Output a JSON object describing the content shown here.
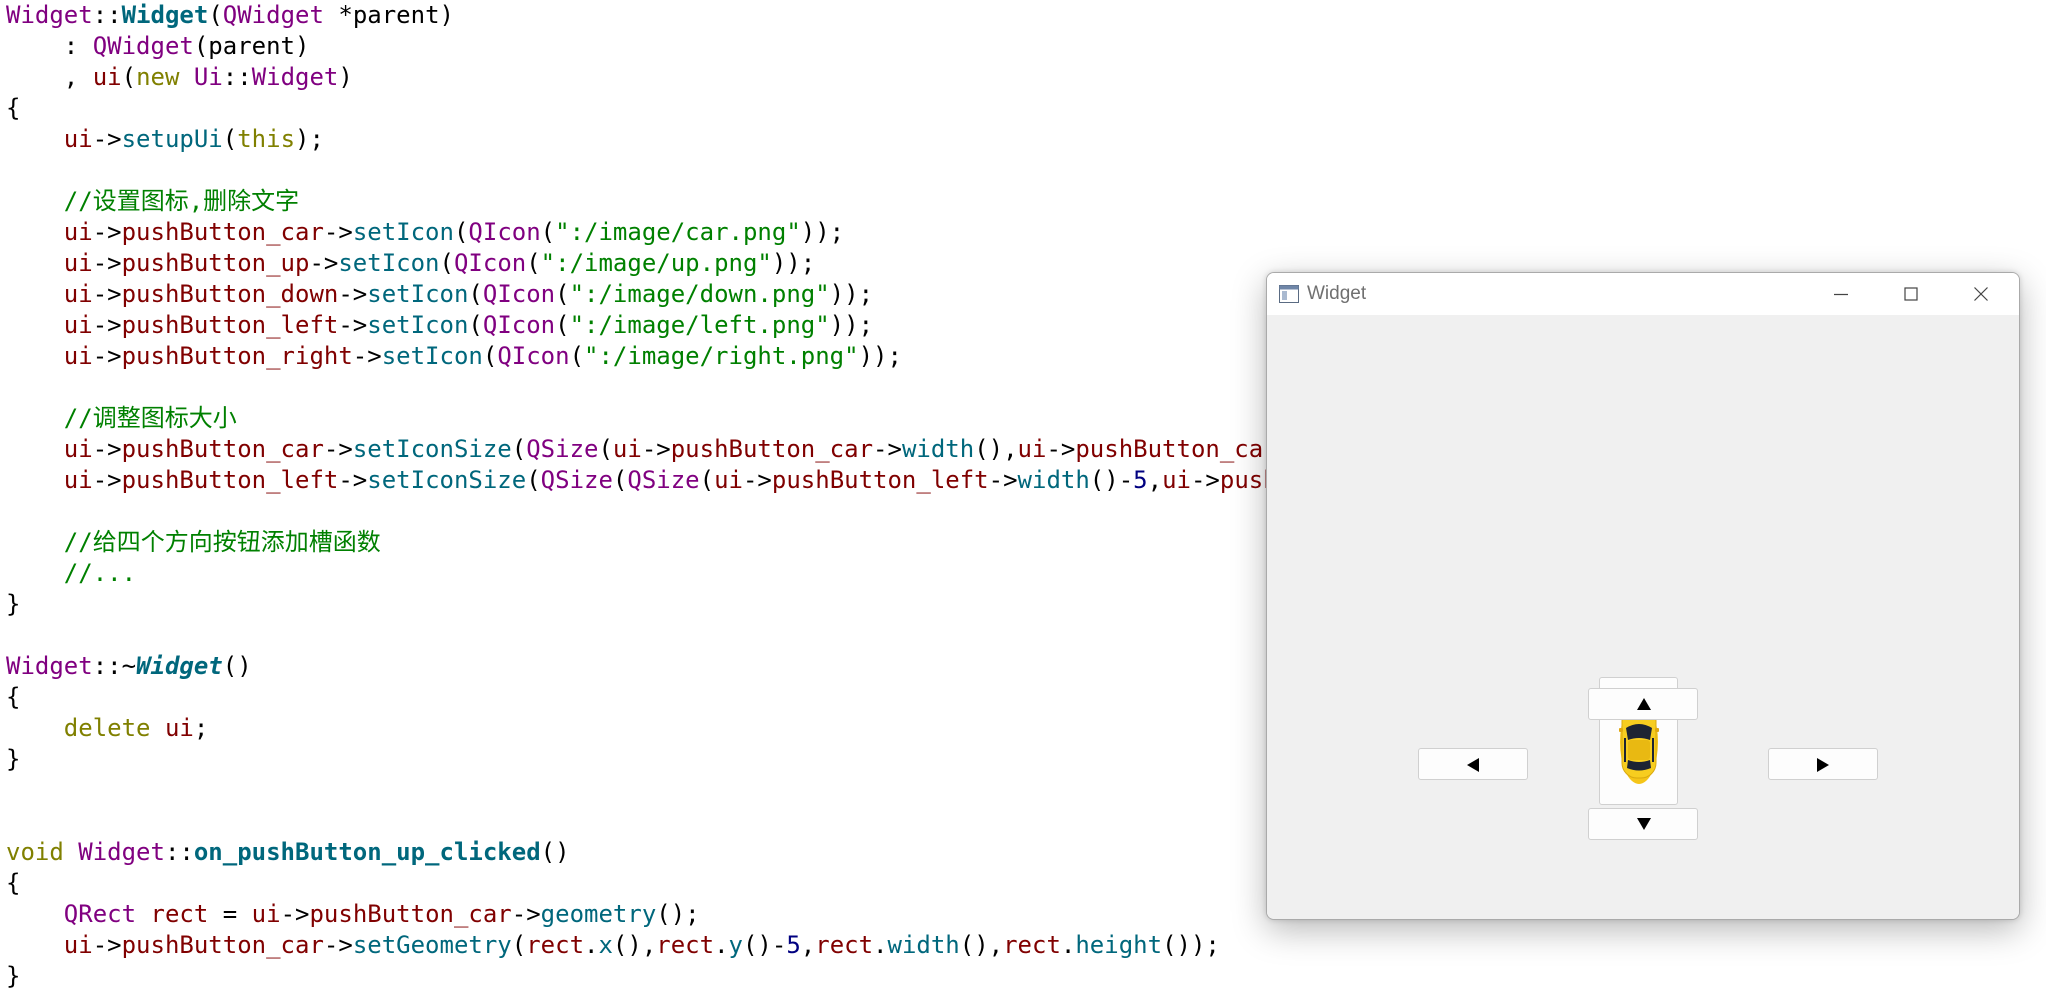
{
  "code_lines": [
    [
      [
        "t-cls",
        "Widget"
      ],
      [
        "t-pl",
        "::"
      ],
      [
        "t-fnb",
        "Widget"
      ],
      [
        "t-pl",
        "("
      ],
      [
        "t-cls",
        "QWidget"
      ],
      [
        "t-pl",
        " *parent)"
      ]
    ],
    [
      [
        "t-pl",
        "    : "
      ],
      [
        "t-cls",
        "QWidget"
      ],
      [
        "t-pl",
        "(parent)"
      ]
    ],
    [
      [
        "t-pl",
        "    , "
      ],
      [
        "t-mem",
        "ui"
      ],
      [
        "t-pl",
        "("
      ],
      [
        "t-kw",
        "new"
      ],
      [
        "t-pl",
        " "
      ],
      [
        "t-cls",
        "Ui"
      ],
      [
        "t-pl",
        "::"
      ],
      [
        "t-cls",
        "Widget"
      ],
      [
        "t-pl",
        ")"
      ]
    ],
    [
      [
        "t-pl",
        "{"
      ]
    ],
    [
      [
        "t-pl",
        "    "
      ],
      [
        "t-mem",
        "ui"
      ],
      [
        "t-pl",
        "->"
      ],
      [
        "t-fn",
        "setupUi"
      ],
      [
        "t-pl",
        "("
      ],
      [
        "t-kw",
        "this"
      ],
      [
        "t-pl",
        ");"
      ]
    ],
    [
      [
        "t-pl",
        ""
      ]
    ],
    [
      [
        "t-com",
        "    //设置图标,删除文字"
      ]
    ],
    [
      [
        "t-pl",
        "    "
      ],
      [
        "t-mem",
        "ui"
      ],
      [
        "t-pl",
        "->"
      ],
      [
        "t-mem",
        "pushButton_car"
      ],
      [
        "t-pl",
        "->"
      ],
      [
        "t-fn",
        "setIcon"
      ],
      [
        "t-pl",
        "("
      ],
      [
        "t-cls",
        "QIcon"
      ],
      [
        "t-pl",
        "("
      ],
      [
        "t-str",
        "\":/image/car.png\""
      ],
      [
        "t-pl",
        "));"
      ]
    ],
    [
      [
        "t-pl",
        "    "
      ],
      [
        "t-mem",
        "ui"
      ],
      [
        "t-pl",
        "->"
      ],
      [
        "t-mem",
        "pushButton_up"
      ],
      [
        "t-pl",
        "->"
      ],
      [
        "t-fn",
        "setIcon"
      ],
      [
        "t-pl",
        "("
      ],
      [
        "t-cls",
        "QIcon"
      ],
      [
        "t-pl",
        "("
      ],
      [
        "t-str",
        "\":/image/up.png\""
      ],
      [
        "t-pl",
        "));"
      ]
    ],
    [
      [
        "t-pl",
        "    "
      ],
      [
        "t-mem",
        "ui"
      ],
      [
        "t-pl",
        "->"
      ],
      [
        "t-mem",
        "pushButton_down"
      ],
      [
        "t-pl",
        "->"
      ],
      [
        "t-fn",
        "setIcon"
      ],
      [
        "t-pl",
        "("
      ],
      [
        "t-cls",
        "QIcon"
      ],
      [
        "t-pl",
        "("
      ],
      [
        "t-str",
        "\":/image/down.png\""
      ],
      [
        "t-pl",
        "));"
      ]
    ],
    [
      [
        "t-pl",
        "    "
      ],
      [
        "t-mem",
        "ui"
      ],
      [
        "t-pl",
        "->"
      ],
      [
        "t-mem",
        "pushButton_left"
      ],
      [
        "t-pl",
        "->"
      ],
      [
        "t-fn",
        "setIcon"
      ],
      [
        "t-pl",
        "("
      ],
      [
        "t-cls",
        "QIcon"
      ],
      [
        "t-pl",
        "("
      ],
      [
        "t-str",
        "\":/image/left.png\""
      ],
      [
        "t-pl",
        "));"
      ]
    ],
    [
      [
        "t-pl",
        "    "
      ],
      [
        "t-mem",
        "ui"
      ],
      [
        "t-pl",
        "->"
      ],
      [
        "t-mem",
        "pushButton_right"
      ],
      [
        "t-pl",
        "->"
      ],
      [
        "t-fn",
        "setIcon"
      ],
      [
        "t-pl",
        "("
      ],
      [
        "t-cls",
        "QIcon"
      ],
      [
        "t-pl",
        "("
      ],
      [
        "t-str",
        "\":/image/right.png\""
      ],
      [
        "t-pl",
        "));"
      ]
    ],
    [
      [
        "t-pl",
        ""
      ]
    ],
    [
      [
        "t-com",
        "    //调整图标大小"
      ]
    ],
    [
      [
        "t-pl",
        "    "
      ],
      [
        "t-mem",
        "ui"
      ],
      [
        "t-pl",
        "->"
      ],
      [
        "t-mem",
        "pushButton_car"
      ],
      [
        "t-pl",
        "->"
      ],
      [
        "t-fn",
        "setIconSize"
      ],
      [
        "t-pl",
        "("
      ],
      [
        "t-cls",
        "QSize"
      ],
      [
        "t-pl",
        "("
      ],
      [
        "t-mem",
        "ui"
      ],
      [
        "t-pl",
        "->"
      ],
      [
        "t-mem",
        "pushButton_car"
      ],
      [
        "t-pl",
        "->"
      ],
      [
        "t-fn",
        "width"
      ],
      [
        "t-pl",
        "(),"
      ],
      [
        "t-mem",
        "ui"
      ],
      [
        "t-pl",
        "->"
      ],
      [
        "t-mem",
        "pushButton_car"
      ]
    ],
    [
      [
        "t-pl",
        "    "
      ],
      [
        "t-mem",
        "ui"
      ],
      [
        "t-pl",
        "->"
      ],
      [
        "t-mem",
        "pushButton_left"
      ],
      [
        "t-pl",
        "->"
      ],
      [
        "t-fn",
        "setIconSize"
      ],
      [
        "t-pl",
        "("
      ],
      [
        "t-cls",
        "QSize"
      ],
      [
        "t-pl",
        "("
      ],
      [
        "t-cls",
        "QSize"
      ],
      [
        "t-pl",
        "("
      ],
      [
        "t-mem",
        "ui"
      ],
      [
        "t-pl",
        "->"
      ],
      [
        "t-mem",
        "pushButton_left"
      ],
      [
        "t-pl",
        "->"
      ],
      [
        "t-fn",
        "width"
      ],
      [
        "t-pl",
        "()-"
      ],
      [
        "t-num",
        "5"
      ],
      [
        "t-pl",
        ","
      ],
      [
        "t-mem",
        "ui"
      ],
      [
        "t-pl",
        "->"
      ],
      [
        "t-mem",
        "push"
      ]
    ],
    [
      [
        "t-pl",
        ""
      ]
    ],
    [
      [
        "t-com",
        "    //给四个方向按钮添加槽函数"
      ]
    ],
    [
      [
        "t-com",
        "    //..."
      ]
    ],
    [
      [
        "t-pl",
        "}"
      ]
    ],
    [
      [
        "t-pl",
        ""
      ]
    ],
    [
      [
        "t-cls",
        "Widget"
      ],
      [
        "t-pl",
        "::~"
      ],
      [
        "t-fnbi",
        "Widget"
      ],
      [
        "t-pl",
        "()"
      ]
    ],
    [
      [
        "t-pl",
        "{"
      ]
    ],
    [
      [
        "t-pl",
        "    "
      ],
      [
        "t-kw",
        "delete"
      ],
      [
        "t-pl",
        " "
      ],
      [
        "t-mem",
        "ui"
      ],
      [
        "t-pl",
        ";"
      ]
    ],
    [
      [
        "t-pl",
        "}"
      ]
    ],
    [
      [
        "t-pl",
        ""
      ]
    ],
    [
      [
        "t-pl",
        ""
      ]
    ],
    [
      [
        "t-kw",
        "void"
      ],
      [
        "t-pl",
        " "
      ],
      [
        "t-cls",
        "Widget"
      ],
      [
        "t-pl",
        "::"
      ],
      [
        "t-fnb",
        "on_pushButton_up_clicked"
      ],
      [
        "t-pl",
        "()"
      ]
    ],
    [
      [
        "t-pl",
        "{"
      ]
    ],
    [
      [
        "t-pl",
        "    "
      ],
      [
        "t-cls",
        "QRect"
      ],
      [
        "t-pl",
        " "
      ],
      [
        "t-mem",
        "rect"
      ],
      [
        "t-pl",
        " = "
      ],
      [
        "t-mem",
        "ui"
      ],
      [
        "t-pl",
        "->"
      ],
      [
        "t-mem",
        "pushButton_car"
      ],
      [
        "t-pl",
        "->"
      ],
      [
        "t-fn",
        "geometry"
      ],
      [
        "t-pl",
        "();"
      ]
    ],
    [
      [
        "t-pl",
        "    "
      ],
      [
        "t-mem",
        "ui"
      ],
      [
        "t-pl",
        "->"
      ],
      [
        "t-mem",
        "pushButton_car"
      ],
      [
        "t-pl",
        "->"
      ],
      [
        "t-fn",
        "setGeometry"
      ],
      [
        "t-pl",
        "("
      ],
      [
        "t-mem",
        "rect"
      ],
      [
        "t-pl",
        "."
      ],
      [
        "t-fn",
        "x"
      ],
      [
        "t-pl",
        "(),"
      ],
      [
        "t-mem",
        "rect"
      ],
      [
        "t-pl",
        "."
      ],
      [
        "t-fn",
        "y"
      ],
      [
        "t-pl",
        "()-"
      ],
      [
        "t-num",
        "5"
      ],
      [
        "t-pl",
        ","
      ],
      [
        "t-mem",
        "rect"
      ],
      [
        "t-pl",
        "."
      ],
      [
        "t-fn",
        "width"
      ],
      [
        "t-pl",
        "(),"
      ],
      [
        "t-mem",
        "rect"
      ],
      [
        "t-pl",
        "."
      ],
      [
        "t-fn",
        "height"
      ],
      [
        "t-pl",
        "());"
      ]
    ],
    [
      [
        "t-pl",
        "}"
      ]
    ]
  ],
  "window": {
    "title": "Widget",
    "icon": "qt-window-icon",
    "controls": [
      "minimize-icon",
      "maximize-icon",
      "close-icon"
    ],
    "buttons": {
      "car": {
        "icon": "car-icon"
      },
      "up": {
        "icon": "arrow-up-icon"
      },
      "left": {
        "icon": "arrow-left-icon"
      },
      "right": {
        "icon": "arrow-right-icon"
      },
      "down": {
        "icon": "arrow-down-icon"
      }
    }
  },
  "colors": {
    "class": "#800080",
    "function": "#00677c",
    "keyword": "#808000",
    "member": "#800000",
    "string": "#008000",
    "comment": "#008000",
    "number": "#000080",
    "window_bg": "#f0f0f0",
    "car_body": "#f5c518"
  }
}
